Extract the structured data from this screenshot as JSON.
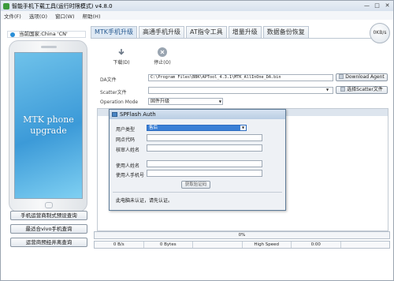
{
  "window": {
    "title": "智能手机下载工具(运行时限模式)  v4.8.0",
    "minimize_glyph": "—",
    "maximize_glyph": "□",
    "close_glyph": "✕"
  },
  "menu": [
    "文件(F)",
    "选项(O)",
    "窗口(W)",
    "帮助(H)"
  ],
  "left": {
    "country_label": "当前国家:China 'CN'",
    "phone_screen_line1": "MTK phone",
    "phone_screen_line2": "upgrade",
    "buttons": [
      "手机运营商制式预设查询",
      "最适合vivo手机查询",
      "运营商预经并离查询"
    ]
  },
  "tabs": [
    {
      "label": "MTK手机升级",
      "active": true
    },
    {
      "label": "高通手机升级",
      "active": false
    },
    {
      "label": "AT指令工具",
      "active": false
    },
    {
      "label": "增量升级",
      "active": false
    },
    {
      "label": "数据备份恢复",
      "active": false
    }
  ],
  "speed_badge": "0KB/s",
  "toolbar": {
    "download_label": "下载(D)",
    "stop_label": "停止(O)"
  },
  "form": {
    "da_label": "DA文件",
    "da_value": "C:\\Program Files\\BBK\\APTool_4.3.1\\MTK_AllInOne_DA.bin",
    "download_agent_button": "Download Agent",
    "scatter_label": "Scatter文件",
    "scatter_value": "",
    "scatter_button": "选择Scatter文件",
    "operation_label": "Operation Mode",
    "operation_value": "固件升级"
  },
  "progress_text": "0%",
  "status": [
    "0 B/s",
    "0 Bytes",
    "",
    "High Speed",
    "0:00",
    ""
  ],
  "dialog": {
    "title": "SPFlash Auth",
    "user_type_label": "用户类型",
    "user_type_value": "售后",
    "outlet_code_label": "网点代码",
    "checker_name_label": "核审人姓名",
    "user_name_label": "使用人姓名",
    "user_phone_label": "使用人手机号",
    "get_code_button": "获取验证码",
    "message": "此电脑未认证，请先认证。"
  },
  "colors": {
    "active_tab_text": "#2a5c92",
    "dialog_border": "#5d7b98",
    "selected_option": "#3a7fd6"
  }
}
